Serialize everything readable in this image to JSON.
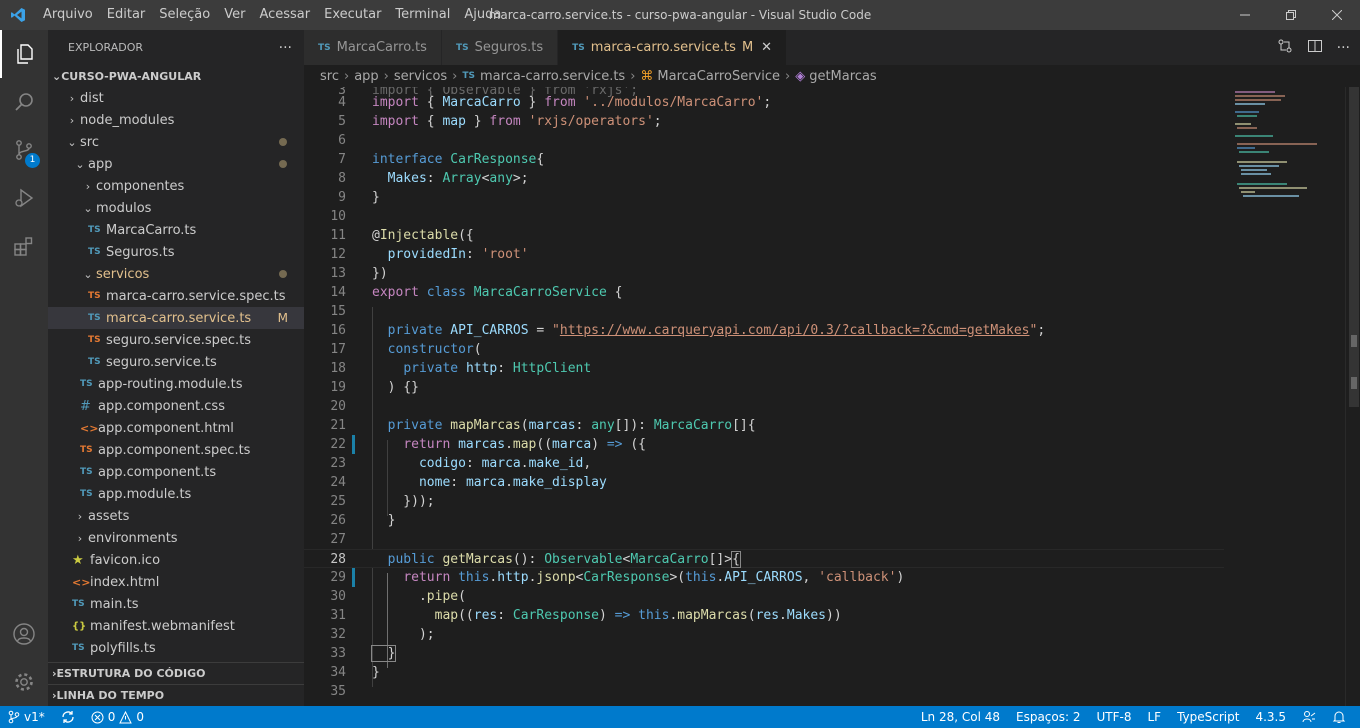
{
  "titlebar": {
    "menu": [
      "Arquivo",
      "Editar",
      "Seleção",
      "Ver",
      "Acessar",
      "Executar",
      "Terminal",
      "Ajuda"
    ],
    "title": "marca-carro.service.ts - curso-pwa-angular - Visual Studio Code"
  },
  "activity": {
    "scm_badge": "1"
  },
  "sidebar": {
    "header": "EXPLORADOR",
    "more": "···",
    "root": "CURSO-PWA-ANGULAR",
    "tree": [
      {
        "label": "dist"
      },
      {
        "label": "node_modules"
      },
      {
        "label": "src"
      },
      {
        "label": "app"
      },
      {
        "label": "componentes"
      },
      {
        "label": "modulos"
      },
      {
        "label": "MarcaCarro.ts",
        "icon": "TS"
      },
      {
        "label": "Seguros.ts",
        "icon": "TS"
      },
      {
        "label": "servicos"
      },
      {
        "label": "marca-carro.service.spec.ts",
        "icon": "TS"
      },
      {
        "label": "marca-carro.service.ts",
        "icon": "TS",
        "status": "M"
      },
      {
        "label": "seguro.service.spec.ts",
        "icon": "TS"
      },
      {
        "label": "seguro.service.ts",
        "icon": "TS"
      },
      {
        "label": "app-routing.module.ts",
        "icon": "TS"
      },
      {
        "label": "app.component.css",
        "icon": "#"
      },
      {
        "label": "app.component.html",
        "icon": "<>"
      },
      {
        "label": "app.component.spec.ts",
        "icon": "TS"
      },
      {
        "label": "app.component.ts",
        "icon": "TS"
      },
      {
        "label": "app.module.ts",
        "icon": "TS"
      },
      {
        "label": "assets"
      },
      {
        "label": "environments"
      },
      {
        "label": "favicon.ico",
        "icon": "★"
      },
      {
        "label": "index.html",
        "icon": "<>"
      },
      {
        "label": "main.ts",
        "icon": "TS"
      },
      {
        "label": "manifest.webmanifest",
        "icon": "{}"
      },
      {
        "label": "polyfills.ts",
        "icon": "TS"
      }
    ],
    "outline": "ESTRUTURA DO CÓDIGO",
    "timeline": "LINHA DO TEMPO"
  },
  "tabs": [
    {
      "label": "MarcaCarro.ts",
      "icon": "TS"
    },
    {
      "label": "Seguros.ts",
      "icon": "TS"
    },
    {
      "label": "marca-carro.service.ts",
      "icon": "TS",
      "modified": "M",
      "close": "✕"
    }
  ],
  "breadcrumb": {
    "parts": [
      "src",
      "app",
      "servicos"
    ],
    "file": "marca-carro.service.ts",
    "class": "MarcaCarroService",
    "method": "getMarcas",
    "file_icon": "TS"
  },
  "code": {
    "line_numbers": [
      "3",
      "4",
      "5",
      "6",
      "7",
      "8",
      "9",
      "10",
      "11",
      "12",
      "13",
      "14",
      "15",
      "16",
      "17",
      "18",
      "19",
      "20",
      "21",
      "22",
      "23",
      "24",
      "25",
      "26",
      "27",
      "28",
      "29",
      "30",
      "31",
      "32",
      "33",
      "34",
      "35"
    ],
    "tokens": {
      "l3": "import { Observable } from 'rxjs';",
      "l4a": "import",
      "l4b": " { ",
      "l4c": "MarcaCarro",
      "l4d": " } ",
      "l4e": "from",
      "l4f": " ",
      "l4g": "'../modulos/MarcaCarro'",
      "l4h": ";",
      "l5a": "import",
      "l5b": " { ",
      "l5c": "map",
      "l5d": " } ",
      "l5e": "from",
      "l5f": " ",
      "l5g": "'rxjs/operators'",
      "l5h": ";",
      "l7a": "interface",
      "l7b": " ",
      "l7c": "CarResponse",
      "l7d": "{",
      "l8a": "  ",
      "l8b": "Makes",
      "l8c": ": ",
      "l8d": "Array",
      "l8e": "<",
      "l8f": "any",
      "l8g": ">;",
      "l9": "}",
      "l11a": "@",
      "l11b": "Injectable",
      "l11c": "({",
      "l12a": "  ",
      "l12b": "providedIn",
      "l12c": ": ",
      "l12d": "'root'",
      "l13": "})",
      "l14a": "export",
      "l14b": " ",
      "l14c": "class",
      "l14d": " ",
      "l14e": "MarcaCarroService",
      "l14f": " {",
      "l16a": "  ",
      "l16b": "private",
      "l16c": " ",
      "l16d": "API_CARROS",
      "l16e": " = ",
      "l16f": "\"",
      "l16g": "https://www.carqueryapi.com/api/0.3/?callback=?&cmd=getMakes",
      "l16h": "\"",
      "l16i": ";",
      "l17a": "  ",
      "l17b": "constructor",
      "l17c": "(",
      "l18a": "    ",
      "l18b": "private",
      "l18c": " ",
      "l18d": "http",
      "l18e": ": ",
      "l18f": "HttpClient",
      "l19": "  ) {}",
      "l21a": "  ",
      "l21b": "private",
      "l21c": " ",
      "l21d": "mapMarcas",
      "l21e": "(",
      "l21f": "marcas",
      "l21g": ": ",
      "l21h": "any",
      "l21i": "[]): ",
      "l21j": "MarcaCarro",
      "l21k": "[]{",
      "l22a": "    ",
      "l22b": "return",
      "l22c": " ",
      "l22d": "marcas",
      "l22e": ".",
      "l22f": "map",
      "l22g": "((",
      "l22h": "marca",
      "l22i": ") ",
      "l22j": "=>",
      "l22k": " ({",
      "l23a": "      ",
      "l23b": "codigo",
      "l23c": ": ",
      "l23d": "marca",
      "l23e": ".",
      "l23f": "make_id",
      "l23g": ",",
      "l24a": "      ",
      "l24b": "nome",
      "l24c": ": ",
      "l24d": "marca",
      "l24e": ".",
      "l24f": "make_display",
      "l25": "    }));",
      "l26": "  }",
      "l28a": "  ",
      "l28b": "public",
      "l28c": " ",
      "l28d": "getMarcas",
      "l28e": "(): ",
      "l28f": "Observable",
      "l28g": "<",
      "l28h": "MarcaCarro",
      "l28i": "[]>",
      "l28j": "{",
      "l29a": "    ",
      "l29b": "return",
      "l29c": " ",
      "l29d": "this",
      "l29e": ".",
      "l29f": "http",
      "l29g": ".",
      "l29h": "jsonp",
      "l29i": "<",
      "l29j": "CarResponse",
      "l29k": ">(",
      "l29l": "this",
      "l29m": ".",
      "l29n": "API_CARROS",
      "l29o": ", ",
      "l29p": "'callback'",
      "l29q": ")",
      "l30a": "      .",
      "l30b": "pipe",
      "l30c": "(",
      "l31a": "        ",
      "l31b": "map",
      "l31c": "((",
      "l31d": "res",
      "l31e": ": ",
      "l31f": "CarResponse",
      "l31g": ") ",
      "l31h": "=>",
      "l31i": " ",
      "l31j": "this",
      "l31k": ".",
      "l31l": "mapMarcas",
      "l31m": "(",
      "l31n": "res",
      "l31o": ".",
      "l31p": "Makes",
      "l31q": "))",
      "l32": "      );",
      "l33": "  }",
      "l34": "}"
    }
  },
  "statusbar": {
    "branch": "v1*",
    "errors": "0",
    "warnings": "0",
    "position": "Ln 28, Col 48",
    "spaces": "Espaços: 2",
    "encoding": "UTF-8",
    "eol": "LF",
    "language": "TypeScript",
    "version": "4.3.5"
  },
  "colors": {
    "accent": "#007acc",
    "titlebar": "#3c3c3c",
    "activitybar": "#333333",
    "sidebar": "#252526",
    "editor": "#1e1e1e",
    "modified": "#e2c08d"
  }
}
